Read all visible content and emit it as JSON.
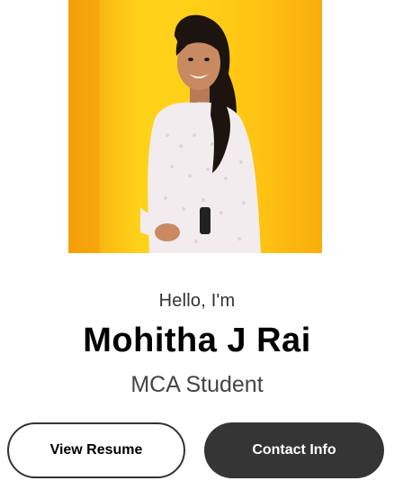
{
  "profile": {
    "photo_alt": "",
    "greeting": "Hello, I'm",
    "name": "Mohitha J Rai",
    "role": "MCA Student"
  },
  "actions": {
    "view_resume_label": "View Resume",
    "contact_info_label": "Contact Info"
  },
  "colors": {
    "photo_background": "#ffcf18",
    "primary_button": "#353535",
    "outline_border": "#333333"
  }
}
